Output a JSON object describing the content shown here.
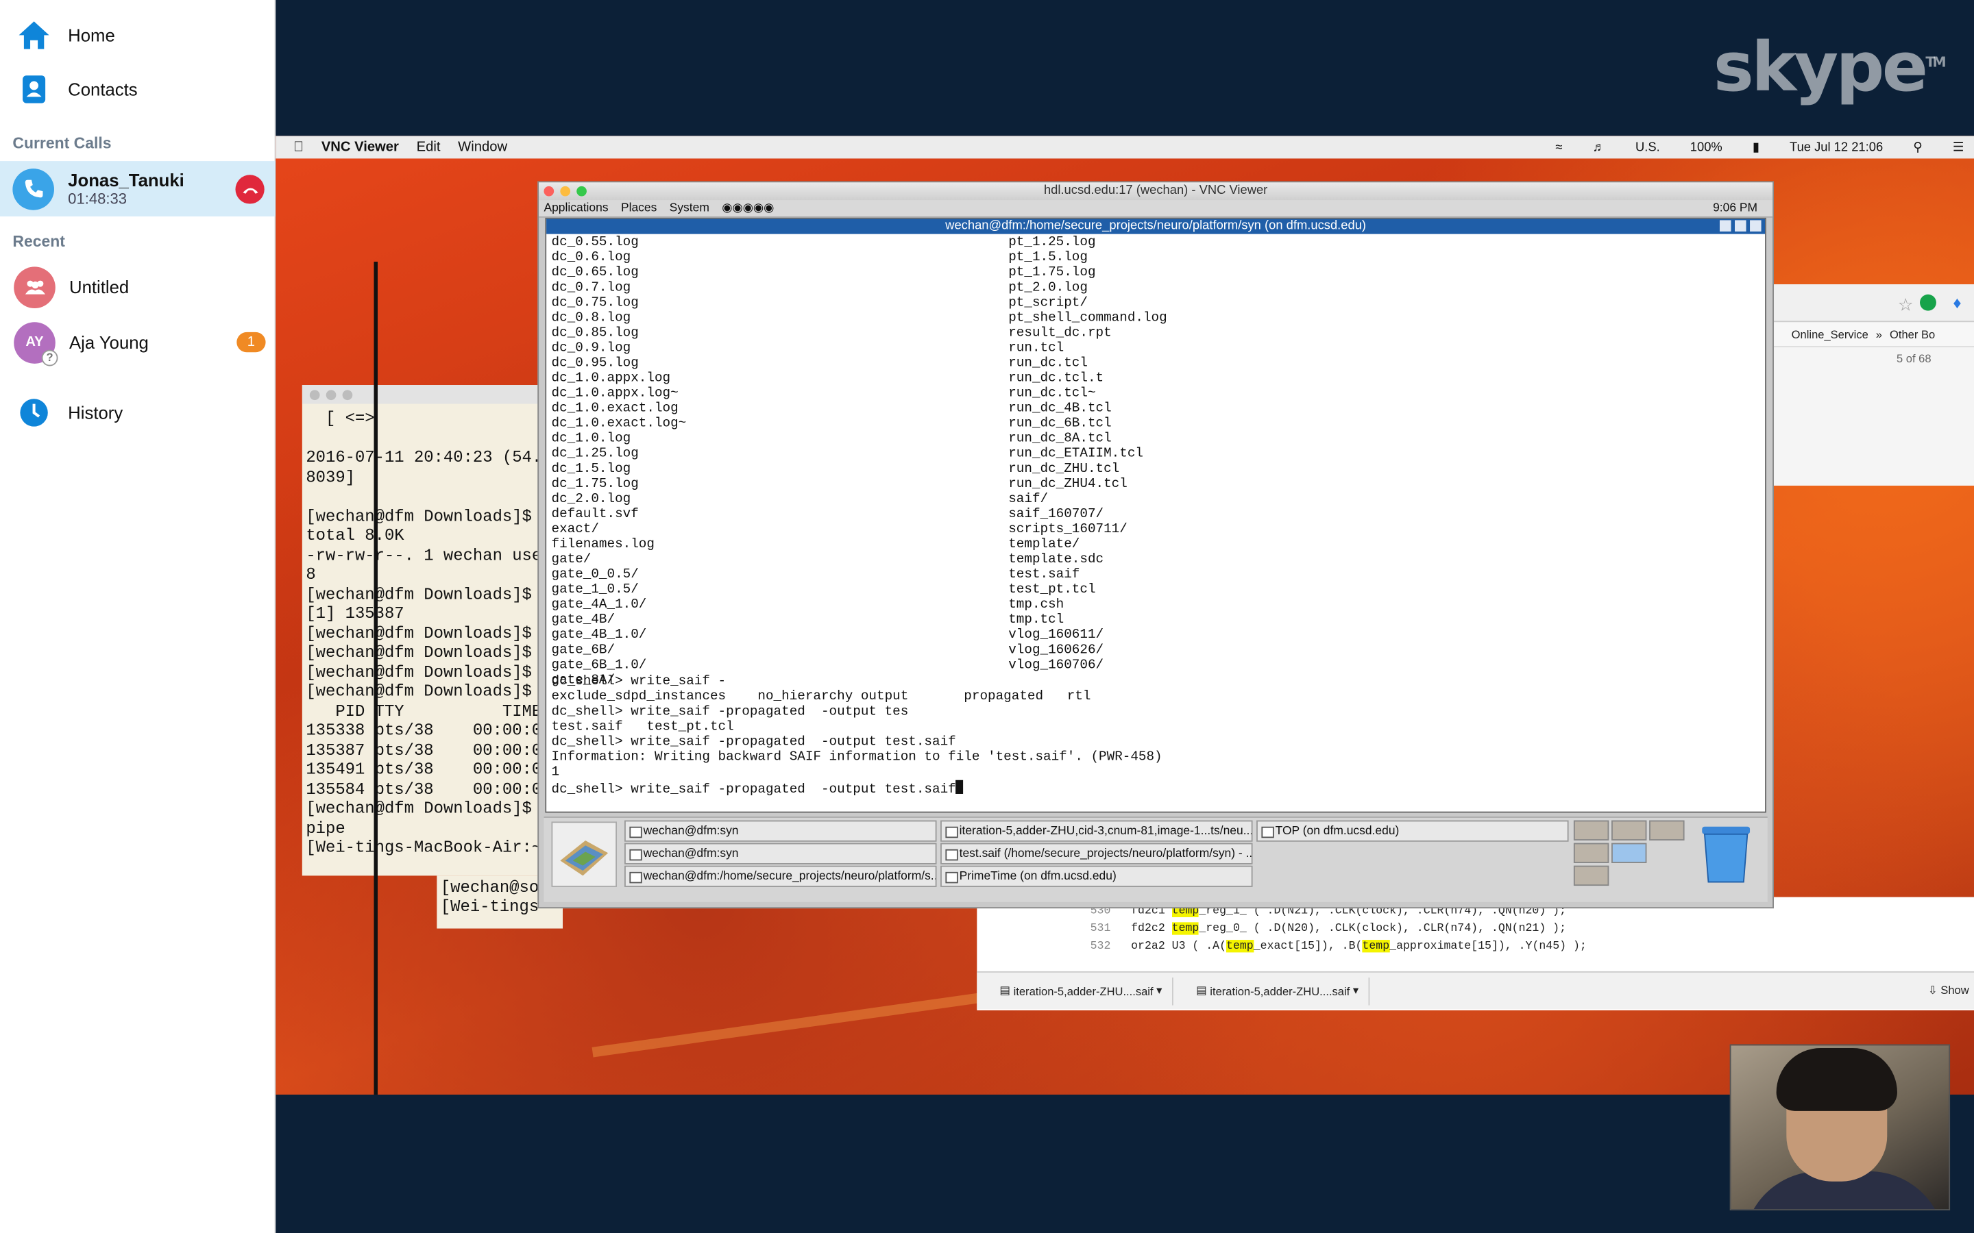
{
  "sidebar": {
    "home": "Home",
    "contacts": "Contacts",
    "current_calls_header": "Current Calls",
    "current_call": {
      "name": "Jonas_Tanuki",
      "duration": "01:48:33"
    },
    "recent_header": "Recent",
    "recent": [
      {
        "name": "Untitled",
        "avatar": "group-icon",
        "color": "#e46f78"
      },
      {
        "name": "Aja Young",
        "initials": "AY",
        "badge": "1",
        "color": "#b36fbf"
      }
    ],
    "history": "History"
  },
  "brand": {
    "logo_text": "skype",
    "tm": "TM"
  },
  "mac_menubar": {
    "app": "VNC Viewer",
    "items": [
      "Edit",
      "Window"
    ],
    "status": {
      "input": "U.S.",
      "battery": "100%",
      "datetime": "Tue Jul 12  21:06"
    }
  },
  "left_terminal": {
    "lines": "  [ <=>\n\n2016-07-11 20:40:23 (54.\n8039]\n\n[wechan@dfm Downloads]$\ntotal 8.0K\n-rw-rw-r--. 1 wechan use\n8\n[wechan@dfm Downloads]$\n[1] 135387\n[wechan@dfm Downloads]$\n[wechan@dfm Downloads]$\n[wechan@dfm Downloads]$\n[wechan@dfm Downloads]$\n   PID TTY          TIME\n135338 pts/38    00:00:00\n135387 pts/38    00:00:04\n135491 pts/38    00:00:00\n135584 pts/38    00:00:00\n[wechan@dfm Downloads]$\npipe\n[Wei-tings-MacBook-Air:~",
    "bottom_lines": "[wechan@so\n[Wei-tings"
  },
  "vnc": {
    "window_title": "hdl.ucsd.edu:17 (wechan) - VNC Viewer",
    "gnome_menu": [
      "Applications",
      "Places",
      "System"
    ],
    "gnome_clock": "9:06 PM",
    "terminal_title": "wechan@dfm:/home/secure_projects/neuro/platform/syn (on dfm.ucsd.edu)",
    "listing_col1": "dc_0.55.log\ndc_0.6.log\ndc_0.65.log\ndc_0.7.log\ndc_0.75.log\ndc_0.8.log\ndc_0.85.log\ndc_0.9.log\ndc_0.95.log\ndc_1.0.appx.log\ndc_1.0.appx.log~\ndc_1.0.exact.log\ndc_1.0.exact.log~\ndc_1.0.log\ndc_1.25.log\ndc_1.5.log\ndc_1.75.log\ndc_2.0.log\ndefault.svf\nexact/\nfilenames.log\ngate/\ngate_0_0.5/\ngate_1_0.5/\ngate_4A_1.0/\ngate_4B/\ngate_4B_1.0/\ngate_6B/\ngate_6B_1.0/\ngate_8A/",
    "listing_col2": "pt_1.25.log\npt_1.5.log\npt_1.75.log\npt_2.0.log\npt_script/\npt_shell_command.log\nresult_dc.rpt\nrun.tcl\nrun_dc.tcl\nrun_dc.tcl.t\nrun_dc.tcl~\nrun_dc_4B.tcl\nrun_dc_6B.tcl\nrun_dc_8A.tcl\nrun_dc_ETAIIM.tcl\nrun_dc_ZHU.tcl\nrun_dc_ZHU4.tcl\nsaif/\nsaif_160707/\nscripts_160711/\ntemplate/\ntemplate.sdc\ntest.saif\ntest_pt.tcl\ntmp.csh\ntmp.tcl\nvlog_160611/\nvlog_160626/\nvlog_160706/",
    "shell_lines": "dc_shell> write_saif -\nexclude_sdpd_instances    no_hierarchy output       propagated   rtl\ndc_shell> write_saif -propagated  -output tes\ntest.saif   test_pt.tcl\ndc_shell> write_saif -propagated  -output test.saif\nInformation: Writing backward SAIF information to file 'test.saif'. (PWR-458)\n1",
    "shell_prompt": "dc_shell> write_saif -propagated  -output test.saif",
    "taskbar": [
      "wechan@dfm:syn",
      "iteration-5,adder-ZHU,cid-3,cnum-81,image-1...ts/neu...",
      "TOP (on dfm.ucsd.edu)",
      "wechan@dfm:syn",
      "test.saif (/home/secure_projects/neuro/platform/syn) - ...",
      "wechan@dfm:/home/secure_projects/neuro/platform/s...",
      "PrimeTime (on dfm.ucsd.edu)"
    ]
  },
  "browser": {
    "bookmarks": [
      "Online_Service",
      "»",
      "Other Bo"
    ],
    "find_count": "5 of 68",
    "code_lines": [
      {
        "ln": "530",
        "text": "fd2c1 temp_reg_1_ ( .D(N21), .CLK(clock), .CLR(n74), .QN(n20) );"
      },
      {
        "ln": "531",
        "text": "fd2c2 temp_reg_0_ ( .D(N20), .CLK(clock), .CLR(n74), .QN(n21) );"
      },
      {
        "ln": "532",
        "text": "or2a2 U3 ( .A(temp_exact[15]), .B(temp_approximate[15]), .Y(n45) );"
      }
    ],
    "downloads": [
      "iteration-5,adder-ZHU....saif",
      "iteration-5,adder-ZHU....saif"
    ],
    "show_all": "Show"
  },
  "colors": {
    "skype_blue": "#0f85d9",
    "hangup_red": "#e0283c",
    "gnome_title_blue": "#1f5ea8"
  }
}
